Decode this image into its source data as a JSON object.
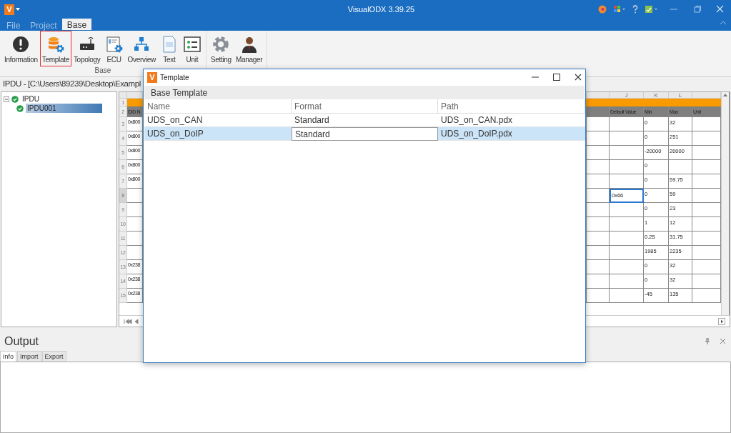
{
  "window": {
    "logo": "V",
    "title": "VisualODX 3.39.25"
  },
  "menu_tabs": [
    {
      "label": "File",
      "selected": false
    },
    {
      "label": "Project",
      "selected": false
    },
    {
      "label": "Base",
      "selected": true
    }
  ],
  "ribbon": {
    "groups": [
      {
        "label": "Base",
        "buttons": [
          {
            "label": "Information",
            "selected": false
          },
          {
            "label": "Template",
            "selected": true
          },
          {
            "label": "Topology",
            "selected": false
          },
          {
            "label": "ECU",
            "selected": false
          },
          {
            "label": "Overview",
            "selected": false
          },
          {
            "label": "Text",
            "selected": false
          },
          {
            "label": "Unit",
            "selected": false
          }
        ]
      },
      {
        "buttons": [
          {
            "label": "Setting",
            "selected": false
          },
          {
            "label": "Manager",
            "selected": false
          }
        ]
      }
    ]
  },
  "document": {
    "title": "IPDU - [C:\\Users\\89239\\Desktop\\Exampl"
  },
  "tree": [
    {
      "label": "IPDU",
      "expanded": true,
      "selected": false,
      "children": [
        {
          "label": "IPDU001",
          "selected": true
        }
      ]
    }
  ],
  "sheet": {
    "column_letters": [
      "J",
      "K",
      "L"
    ],
    "row_1": "1",
    "header": {
      "row_number": "2",
      "column_1": "DID N",
      "default": "Default Value",
      "min": "Min",
      "max": "Max",
      "unit": "Unit"
    },
    "rows": [
      {
        "num": "3",
        "column_1": "0x800",
        "min": "0",
        "max": "32",
        "selected": false
      },
      {
        "num": "4",
        "column_1": "0x800",
        "min": "0",
        "max": "251",
        "selected": false
      },
      {
        "num": "5",
        "column_1": "0x800",
        "min": "-20000",
        "max": "20000",
        "selected": false
      },
      {
        "num": "6",
        "column_1": "0x800",
        "min": "0",
        "selected": false
      },
      {
        "num": "7",
        "column_1": "0x800",
        "min": "0",
        "max": "59.75",
        "selected": false
      },
      {
        "num": "8",
        "default": "0x66",
        "min": "0",
        "max": "59",
        "selected": true
      },
      {
        "num": "9",
        "min": "0",
        "max": "23",
        "selected": false
      },
      {
        "num": "10",
        "min": "1",
        "max": "12",
        "selected": false
      },
      {
        "num": "11",
        "min": "0.25",
        "max": "31.75",
        "selected": false
      },
      {
        "num": "12",
        "min": "1985",
        "max": "2235",
        "selected": false
      },
      {
        "num": "13",
        "column_1": "0x238",
        "min": "0",
        "max": "32",
        "selected": false
      },
      {
        "num": "14",
        "column_1": "0x238",
        "min": "0",
        "max": "32",
        "selected": false
      },
      {
        "num": "15",
        "column_1": "0x238",
        "min": "-45",
        "max": "135",
        "selected": false
      }
    ]
  },
  "dialog": {
    "logo": "V",
    "title": "Template",
    "heading": "Base Template",
    "columns": [
      "Name",
      "Format",
      "Path"
    ],
    "rows": [
      {
        "cells": [
          "UDS_on_CAN",
          "Standard",
          "UDS_on_CAN.pdx"
        ],
        "selected": false
      },
      {
        "cells": [
          "UDS_on_DoIP",
          "Standard",
          "UDS_on_DoIP.pdx"
        ],
        "selected": true
      }
    ]
  },
  "output": {
    "title": "Output",
    "tabs": [
      {
        "label": "Info",
        "selected": true
      },
      {
        "label": "Import",
        "selected": false
      },
      {
        "label": "Export",
        "selected": false
      }
    ]
  }
}
